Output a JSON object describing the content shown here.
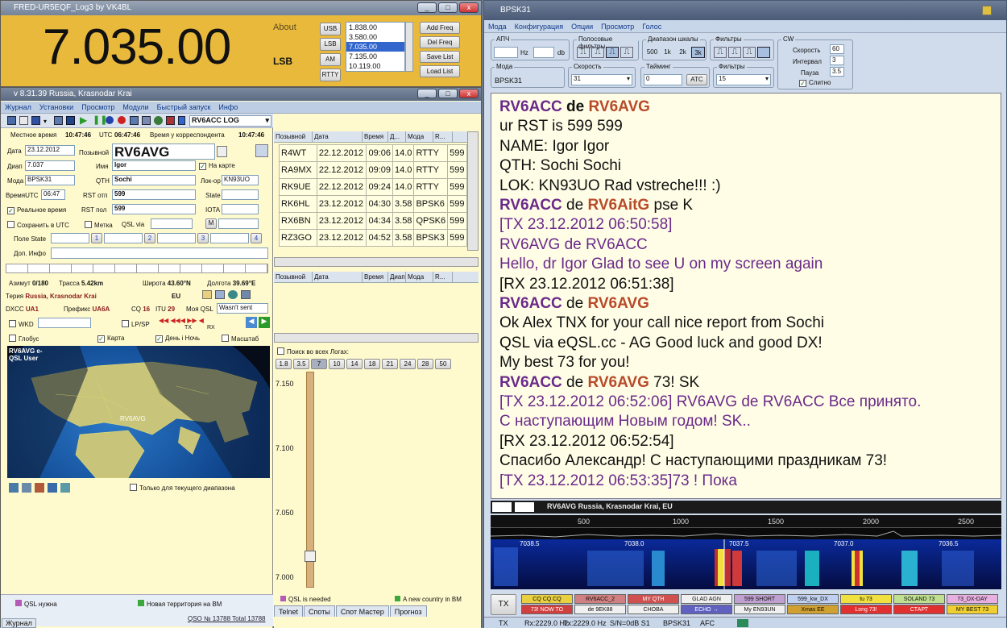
{
  "freq_window": {
    "title": "FRED-UR5EQF_Log3 by VK4BL",
    "frequency": "7.035.00",
    "about": "About",
    "mode": "LSB",
    "mode_buttons": [
      "USB",
      "LSB",
      "AM",
      "RTTY"
    ],
    "freq_list": [
      "1.838.00",
      "3.580.00",
      "7.035.00",
      "7.135.00",
      "10.119.00"
    ],
    "selected_freq_index": 2,
    "list_buttons": [
      "Add Freq",
      "Del Freq",
      "Save List",
      "Load List"
    ]
  },
  "log_window": {
    "title": "v 8.31.39 Russia, Krasnodar Krai",
    "menu": [
      "Журнал",
      "Установки",
      "Просмотр",
      "Модули",
      "Быстрый запуск",
      "Инфо"
    ],
    "log_name": "RV6ACC LOG",
    "local_time_label": "Местное время",
    "local_time": "10:47:46",
    "utc_label": "UTC",
    "utc": "06:47:46",
    "corr_time_label": "Время у корреспондента",
    "corr_time": "10:47:46",
    "date_label": "Дата",
    "date": "23.12.2012",
    "callsign_label": "Позывной",
    "callsign": "RV6AVG",
    "band_label": "Диап",
    "band": "7.037",
    "name_label": "Имя",
    "name": "Igor",
    "on_map_label": "На карте",
    "mode_label": "Мода",
    "mode": "BPSK31",
    "qth_label": "QTH",
    "qth": "Sochi",
    "loc_label": "Лок-ор",
    "loc": "KN93UO",
    "time_label": "ВремяUTC",
    "time": "06:47",
    "rst_sent_label": "RST отп",
    "rst_sent": "599",
    "state_label": "State",
    "realtime_label": "Реальное время",
    "rst_rcvd_label": "RST пол",
    "rst_rcvd": "599",
    "iota_label": "IOTA",
    "save_utc_label": "Сохранить в UTC",
    "mark_label": "Метка",
    "qsl_via_label": "QSL via",
    "m_label": "M",
    "state_field_label": "Поле State",
    "state_nums": [
      "1",
      "2",
      "3",
      "4"
    ],
    "extra_info_label": "Доп. Инфо",
    "azimuth_label": "Азимут",
    "azimuth": "0/180",
    "path_label": "Трасса",
    "path": "5.42km",
    "lat_label": "Широта",
    "lat": "43.60°N",
    "lon_label": "Долгота",
    "lon": "39.69°E",
    "territory_label": "Терия",
    "territory": "Russia, Krasnodar Krai",
    "continent": "EU",
    "dxcc_label": "DXCC",
    "dxcc": "UA1",
    "prefix_label": "Префикс",
    "prefix": "UA6A",
    "cq_label": "CQ",
    "cq": "16",
    "itu_label": "ITU",
    "itu": "29",
    "myqsl_label": "Моя QSL",
    "myqsl": "Wasn't sent",
    "wkd_label": "WKD",
    "lpsp_label": "LP/SP",
    "tx_label": "TX",
    "rx_label": "RX",
    "globe_label": "Глобус",
    "map_label": "Карта",
    "daynight_label": "День і Ночь",
    "scale_label": "Масштаб",
    "map_caption": "RV6AVG e-QSL User",
    "map_marker": "RV6AVG",
    "current_band_label": "Только для текущего диапазона",
    "footer_qsl": "QSL нужна",
    "footer_new": "Новая территория на ВМ",
    "footer_qso": "QSO № 13788 Total 13788"
  },
  "qso_table": {
    "headers": [
      "Позывной",
      "Дата",
      "Время",
      "Д...",
      "Мода",
      "R..."
    ],
    "rows": [
      [
        "R4WT",
        "22.12.2012",
        "09:06",
        "14.0",
        "RTTY",
        "599"
      ],
      [
        "RA9MX",
        "22.12.2012",
        "09:09",
        "14.0",
        "RTTY",
        "599"
      ],
      [
        "RK9UE",
        "22.12.2012",
        "09:24",
        "14.0",
        "RTTY",
        "599"
      ],
      [
        "RK6HL",
        "23.12.2012",
        "04:30",
        "3.58",
        "BPSK6",
        "599"
      ],
      [
        "RX6BN",
        "23.12.2012",
        "04:34",
        "3.58",
        "QPSK6",
        "599"
      ],
      [
        "RZ3GO",
        "23.12.2012",
        "04:52",
        "3.58",
        "BPSK3",
        "599"
      ]
    ],
    "headers2": [
      "Позывной",
      "Дата",
      "Время",
      "Диап",
      "Мода",
      "R..."
    ],
    "search_all": "Поиск во всех Логах:",
    "bands": [
      "1.8",
      "3.5",
      "7",
      "10",
      "14",
      "18",
      "21",
      "24",
      "28",
      "50"
    ],
    "scale_ticks": [
      "7.150",
      "7.100",
      "7.050",
      "7.000"
    ],
    "qsl_needed": "QSL is needed",
    "new_country": "A new country in BM",
    "tabs": [
      "Telnet",
      "Споты",
      "Спот Мастер",
      "Прогноз"
    ],
    "bottom_tab": "Журнал"
  },
  "bpsk_window": {
    "title": "BPSK31",
    "menu": [
      "Мода",
      "Конфигурация",
      "Опции",
      "Просмотр",
      "Голос"
    ],
    "apch_label": "АПЧ",
    "hz": "Hz",
    "db": "db",
    "voice_filters_label": "Полосовые фильтры",
    "scale_range_label": "Диапазон шкалы",
    "scale_vals": [
      "500",
      "1k",
      "2k",
      "3k"
    ],
    "filters_label": "Фильтры",
    "cw_label": "CW",
    "speed_label": "Скорость",
    "speed": "60",
    "interval_label": "Интервал",
    "interval": "3",
    "pause_label": "Пауза",
    "pause": "3.5",
    "sync_label": "Слитно",
    "mode_label": "Мода",
    "mode": "BPSK31",
    "speed2_label": "Скорость",
    "speed2": "31",
    "timing_label": "Тайминг",
    "timing": "0",
    "atc": "ATC",
    "filters2_label": "Фильтры",
    "filters2": "15",
    "spectrum_caption": "RV6AVG Russia, Krasnodar Krai, EU",
    "audio_ticks": [
      "500",
      "1000",
      "1500",
      "2000",
      "2500"
    ],
    "wf_ticks": [
      "7038.5",
      "7038.0",
      "7037.5",
      "7037.0",
      "7036.5"
    ],
    "tx_btn": "TX",
    "macros": [
      [
        "CQ CQ CQ",
        "RV6ACC_2",
        "MY QTH",
        "GLAD AGN",
        "599 SHORT",
        "599_kw_DX",
        "tu 73",
        "SOLAND 73",
        "73_DX-DAY"
      ],
      [
        "73! NOW TO",
        "de 9EK88",
        "CHOBA",
        "ECHO →",
        "My EN93UN",
        "Xmas EE",
        "Long 73!",
        "СТАРТ",
        "MY BEST 73"
      ]
    ],
    "macro_colors": [
      [
        "#e8d040",
        "#d08080",
        "#d05050",
        "#f0f0f0",
        "#c0a0d0",
        "#c0d0f0",
        "#f0e040",
        "#c0e090",
        "#e8b0e0"
      ],
      [
        "#d04040",
        "#f0f0f0",
        "#f0f0f0",
        "#6060c0",
        "#f0f0f0",
        "#d0a030",
        "#e03030",
        "#e03030",
        "#f0d030"
      ]
    ],
    "status": [
      "TX",
      "Rx:2229.0 Hz",
      "Tx:2229.0 Hz",
      "S/N=0dB S1",
      "BPSK31",
      "AFC"
    ],
    "chat": [
      [
        [
          "RV6ACC",
          "cr b"
        ],
        [
          " de ",
          "cb2 b"
        ],
        [
          "RV6AVG",
          "cc b"
        ]
      ],
      [
        [
          "ur RST is 599 599",
          "cb2"
        ]
      ],
      [
        [
          "NAME:  Igor  Igor",
          "cb2"
        ]
      ],
      [
        [
          "QTH:    Sochi  Sochi",
          "cb2"
        ]
      ],
      [
        [
          "LOK:    KN93UO   Rad vstreche!!! :)",
          "cb2"
        ]
      ],
      [
        [
          "RV6ACC",
          "cr b"
        ],
        [
          " de ",
          "cb2"
        ],
        [
          "RV6AitG",
          "cc b"
        ],
        [
          " pse K",
          "cb2"
        ]
      ],
      [
        [
          "[TX 23.12.2012 06:50:58]",
          "cr"
        ]
      ],
      [
        [
          "RV6AVG de RV6ACC",
          "cr"
        ]
      ],
      [
        [
          "Hello, dr Igor Glad to see U on my screen again",
          "cr"
        ]
      ],
      [
        [
          "[RX 23.12.2012 06:51:38]",
          "cb2"
        ]
      ],
      [
        [
          "RV6ACC",
          "cr b"
        ],
        [
          " de ",
          "cb2"
        ],
        [
          "RV6AVG",
          "cc b"
        ]
      ],
      [
        [
          "Ok Alex TNX for your call nice report from Sochi",
          "cb2"
        ]
      ],
      [
        [
          "QSL via eQSL.cc - AG Good luck and good DX!",
          "cb2"
        ]
      ],
      [
        [
          "My best 73 for you!",
          "cb2"
        ]
      ],
      [
        [
          "RV6ACC",
          "cr b"
        ],
        [
          " de ",
          "cb2"
        ],
        [
          "RV6AVG",
          "cc b"
        ],
        [
          " 73! SK",
          "cb2"
        ]
      ],
      [
        [
          "[TX 23.12.2012 06:52:06]  RV6AVG de RV6ACC  Все принято.",
          "cr"
        ]
      ],
      [
        [
          "С наступающим Новым годом! SK..",
          "cr"
        ]
      ],
      [
        [
          "[RX 23.12.2012 06:52:54]",
          "cb2"
        ]
      ],
      [
        [
          "Спасибо Александр! С наступающими праздникам 73!",
          "cb2"
        ]
      ],
      [
        [
          "[TX 23.12.2012 06:53:35]73 ! Пока",
          "cr"
        ]
      ]
    ]
  }
}
